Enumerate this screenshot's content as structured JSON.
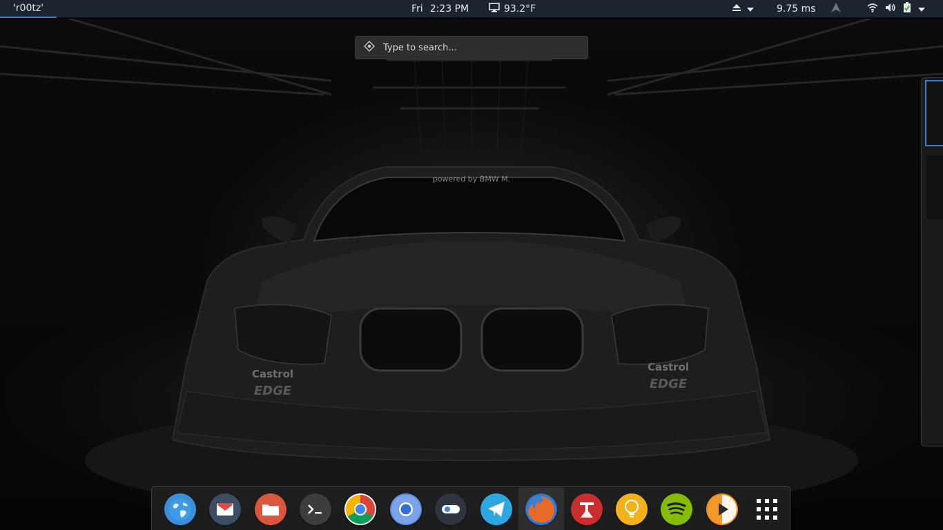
{
  "topbar": {
    "activities_label": "'r00tz'",
    "day": "Fri",
    "time": "2:23 PM",
    "temperature": "93.2°F",
    "ping": "9.75 ms"
  },
  "search": {
    "placeholder": "Type to search..."
  },
  "wallpaper": {
    "windshield_text": "powered by BMW M.",
    "sponsor_left": "Castrol",
    "sponsor_left_sub": "EDGE",
    "sponsor_right": "Castrol",
    "sponsor_right_sub": "EDGE"
  },
  "dock": {
    "apps": [
      {
        "name": "web-browser",
        "icon": "globe-icon",
        "color": "#3a8fd8"
      },
      {
        "name": "mail",
        "icon": "mail-icon",
        "color": "#3c4d66"
      },
      {
        "name": "files",
        "icon": "folder-icon",
        "color": "#d9573d"
      },
      {
        "name": "terminal",
        "icon": "terminal-icon",
        "color": "#3d3d3d"
      },
      {
        "name": "chrome",
        "icon": "chrome-icon",
        "color": "#ffffff"
      },
      {
        "name": "chromium",
        "icon": "chromium-icon",
        "color": "#5c8fe0"
      },
      {
        "name": "settings",
        "icon": "toggle-icon",
        "color": "#2e3440"
      },
      {
        "name": "telegram",
        "icon": "telegram-icon",
        "color": "#2ea6e0"
      },
      {
        "name": "firefox",
        "icon": "firefox-icon",
        "color": "#2a75c9"
      },
      {
        "name": "font-manager",
        "icon": "font-icon",
        "color": "#c82e2e"
      },
      {
        "name": "ideas",
        "icon": "lightbulb-icon",
        "color": "#f2b21b"
      },
      {
        "name": "spotify",
        "icon": "spotify-icon",
        "color": "#84bd00"
      },
      {
        "name": "media-player",
        "icon": "play-icon",
        "color": "#f08c1c"
      },
      {
        "name": "show-apps",
        "icon": "grid-icon",
        "color": "#ffffff"
      }
    ]
  }
}
